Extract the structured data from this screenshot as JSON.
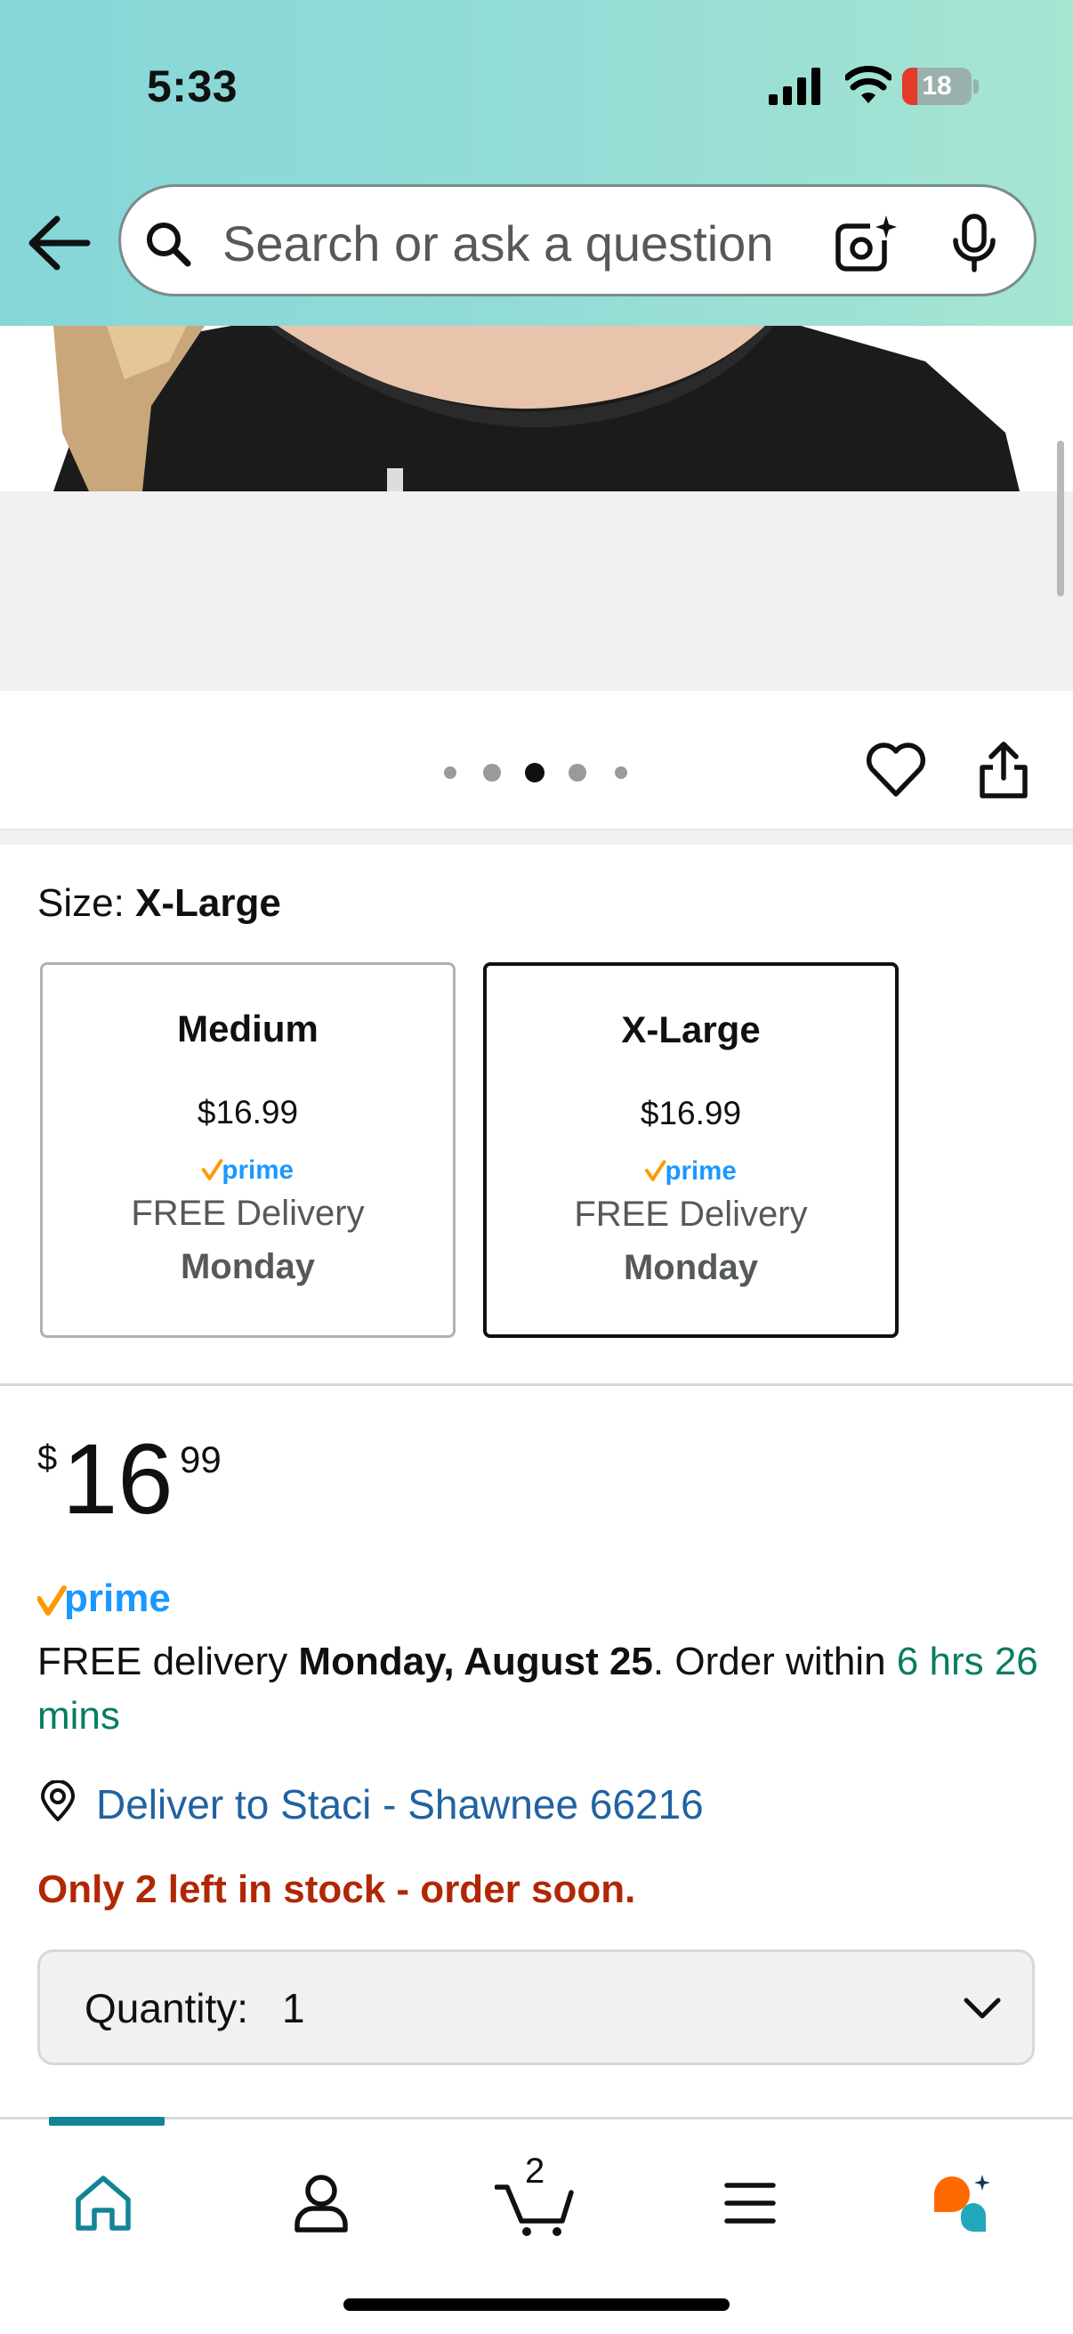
{
  "status_bar": {
    "time": "5:33",
    "battery": "18"
  },
  "search": {
    "placeholder": "Search or ask a question"
  },
  "image_carousel": {
    "total_dots": 5,
    "active_dot": 3
  },
  "size": {
    "label": "Size: ",
    "selected": "X-Large",
    "options": [
      {
        "name": "Medium",
        "price": "$16.99",
        "delivery": "FREE Delivery",
        "day": "Monday"
      },
      {
        "name": "X-Large",
        "price": "$16.99",
        "delivery": "FREE Delivery",
        "day": "Monday"
      }
    ]
  },
  "price": {
    "symbol": "$",
    "whole": "16",
    "fraction": "99"
  },
  "prime_label": "prime",
  "delivery": {
    "prefix": "FREE delivery ",
    "date": "Monday, August 25",
    "middle": ". Order within ",
    "countdown": "6 hrs 26 mins"
  },
  "deliver_to": "Deliver to Staci - Shawnee 66216",
  "stock": "Only 2 left in stock - order soon.",
  "quantity": {
    "label": "Quantity:",
    "value": "1"
  },
  "bottom_nav": {
    "cart_count": "2"
  },
  "colors": {
    "link": "#2162a1",
    "stock": "#b12704",
    "countdown": "#067d62",
    "prime_blue": "#1a98ff",
    "prime_check": "#ff9900",
    "nav_active": "#138496",
    "rufus_orange": "#ff6a00"
  }
}
